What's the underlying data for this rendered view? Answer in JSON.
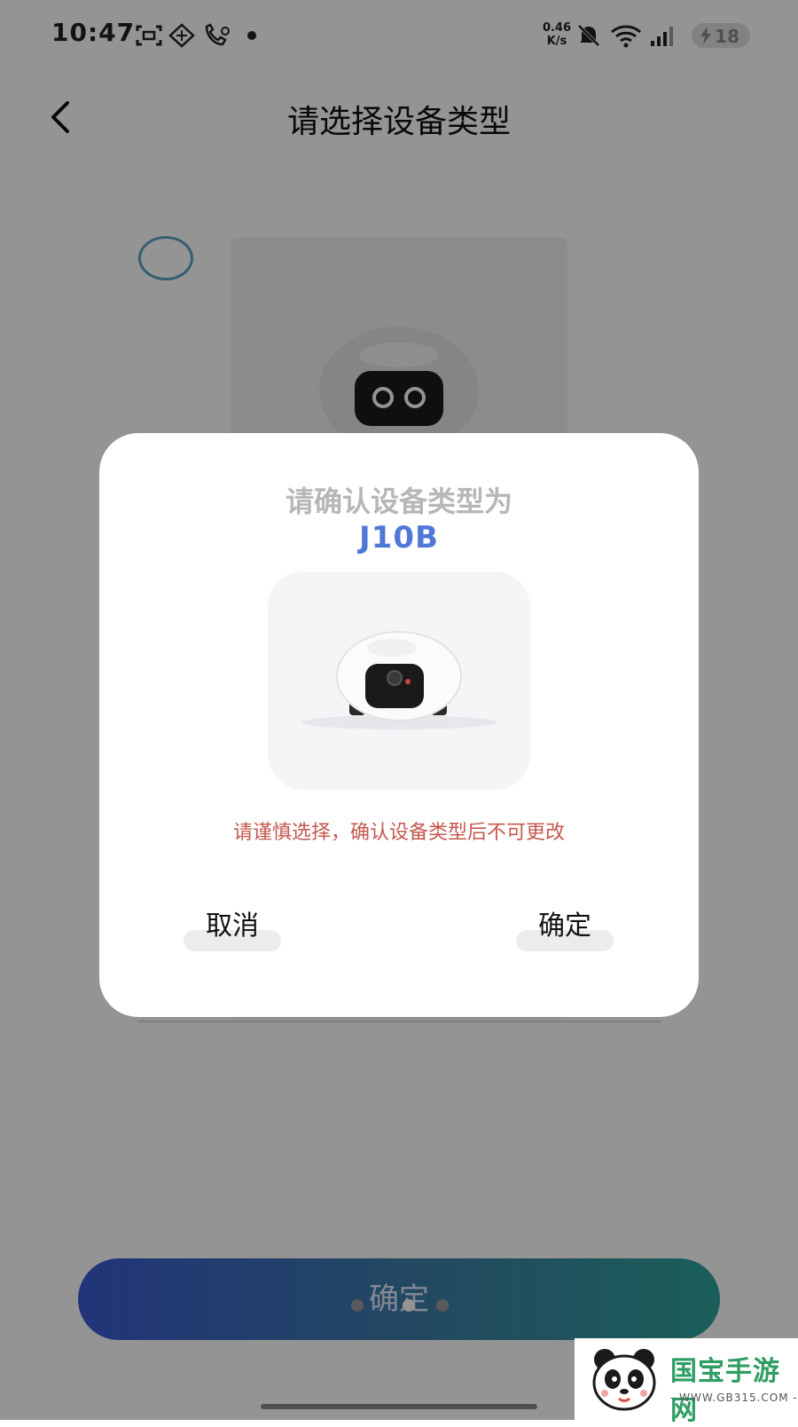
{
  "status_bar": {
    "time": "10:47",
    "net_speed_value": "0.46",
    "net_speed_unit": "K/s",
    "battery_level": "18",
    "icons": [
      "screenshot-icon",
      "scan-icon",
      "call-icon",
      "dot-icon",
      "mute-icon",
      "wifi-icon",
      "signal-icon",
      "charging-icon"
    ]
  },
  "header": {
    "title": "请选择设备类型"
  },
  "background": {
    "confirm_button_label": "确定",
    "pager": {
      "count": 3,
      "active_index": 1
    }
  },
  "dialog": {
    "title": "请确认设备类型为",
    "model": "J10B",
    "warning": "请谨慎选择，确认设备类型后不可更改",
    "cancel_label": "取消",
    "confirm_label": "确定"
  },
  "watermark": {
    "text": "国宝手游网",
    "url": "- WWW.GB315.COM -"
  },
  "colors": {
    "accent_blue": "#4f78d9",
    "warning_red": "#c5584e",
    "gradient_start": "#3a5bd0",
    "gradient_end": "#2fa39a"
  }
}
